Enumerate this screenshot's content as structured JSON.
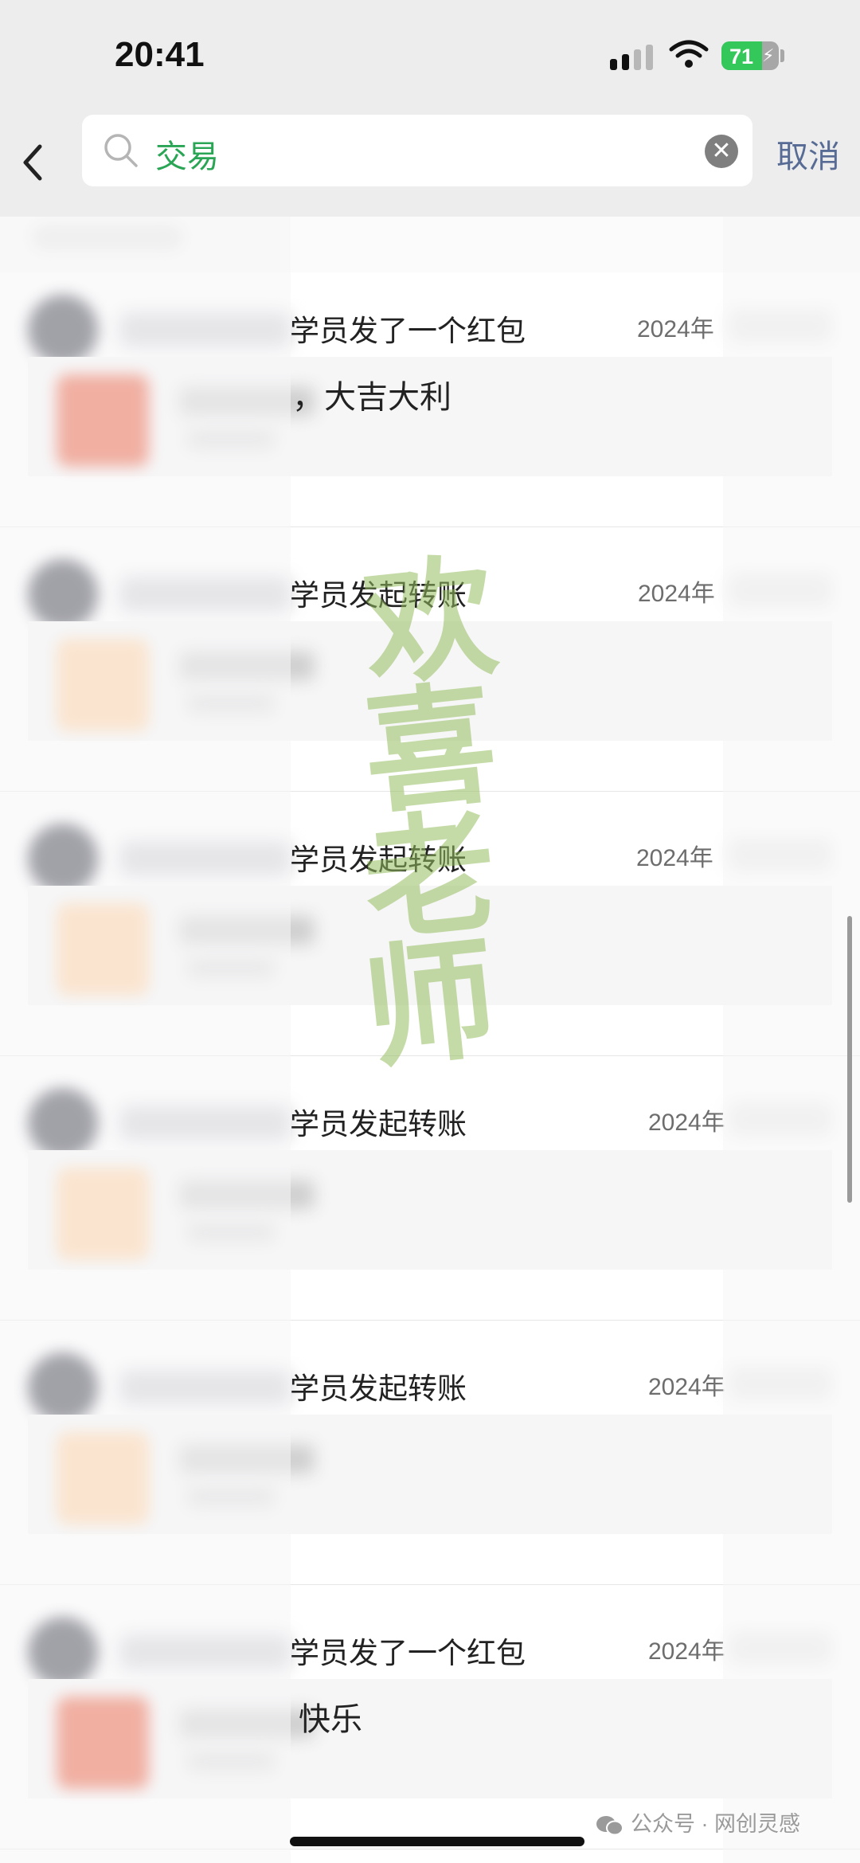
{
  "status_bar": {
    "time": "20:41",
    "battery": "71"
  },
  "search": {
    "query": "交易",
    "clear_glyph": "✕",
    "cancel_label": "取消"
  },
  "results": [
    {
      "title": "学员发了一个红包",
      "date": "2024年",
      "card_text": "，大吉大利",
      "card_type": "red-packet"
    },
    {
      "title": "学员发起转账",
      "date": "2024年",
      "card_text": "",
      "card_type": "transfer"
    },
    {
      "title": "学员发起转账",
      "date": "2024年",
      "card_text": "",
      "card_type": "transfer"
    },
    {
      "title": "学员发起转账",
      "date": "2024年",
      "card_text": "",
      "card_type": "transfer"
    },
    {
      "title": "学员发起转账",
      "date": "2024年",
      "card_text": "",
      "card_type": "transfer"
    },
    {
      "title": "学员发了一个红包",
      "date": "2024年",
      "card_text": "快乐",
      "card_type": "red-packet"
    }
  ],
  "watermark": {
    "chars": [
      "欢",
      "喜",
      "老",
      "师"
    ]
  },
  "footer": {
    "source": "公众号 · 网创灵感"
  },
  "colors": {
    "accent_green": "#2aa555",
    "link_blue": "#576b95",
    "red_packet": "#ea5a3a",
    "transfer": "#ffcf9e"
  },
  "icons": [
    "back-chevron-icon",
    "search-icon",
    "clear-icon",
    "wifi-icon",
    "battery-icon",
    "wechat-icon"
  ]
}
